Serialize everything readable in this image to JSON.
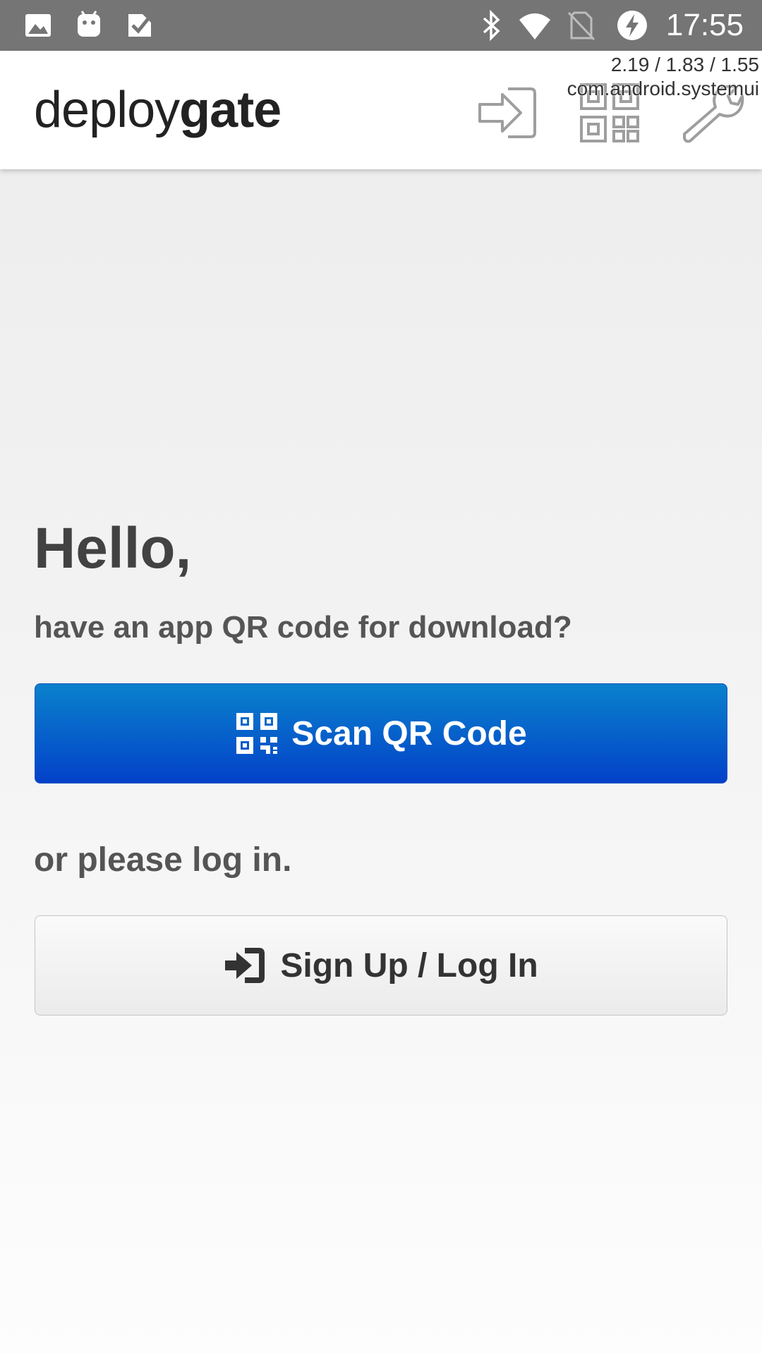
{
  "status_bar": {
    "time": "17:55",
    "icons": [
      "gallery-icon",
      "android-icon",
      "deploygate-check-icon",
      "bluetooth-icon",
      "wifi-icon",
      "no-sim-icon",
      "battery-charging-icon"
    ]
  },
  "overlay": {
    "load": "2.19 / 1.83 / 1.55",
    "process": "com.android.systemui"
  },
  "app_bar": {
    "logo_light": "deploy",
    "logo_bold": "gate",
    "actions": [
      "login-icon",
      "qr-code-icon",
      "wrench-icon"
    ]
  },
  "main": {
    "greeting": "Hello,",
    "question": "have an app QR code for download?",
    "scan_label": "Scan QR Code",
    "alt_prompt": "or please log in.",
    "login_label": "Sign Up / Log In"
  },
  "colors": {
    "status_bar": "#757575",
    "scan_button_top": "#0a82cc",
    "scan_button_bottom": "#0341c9"
  }
}
